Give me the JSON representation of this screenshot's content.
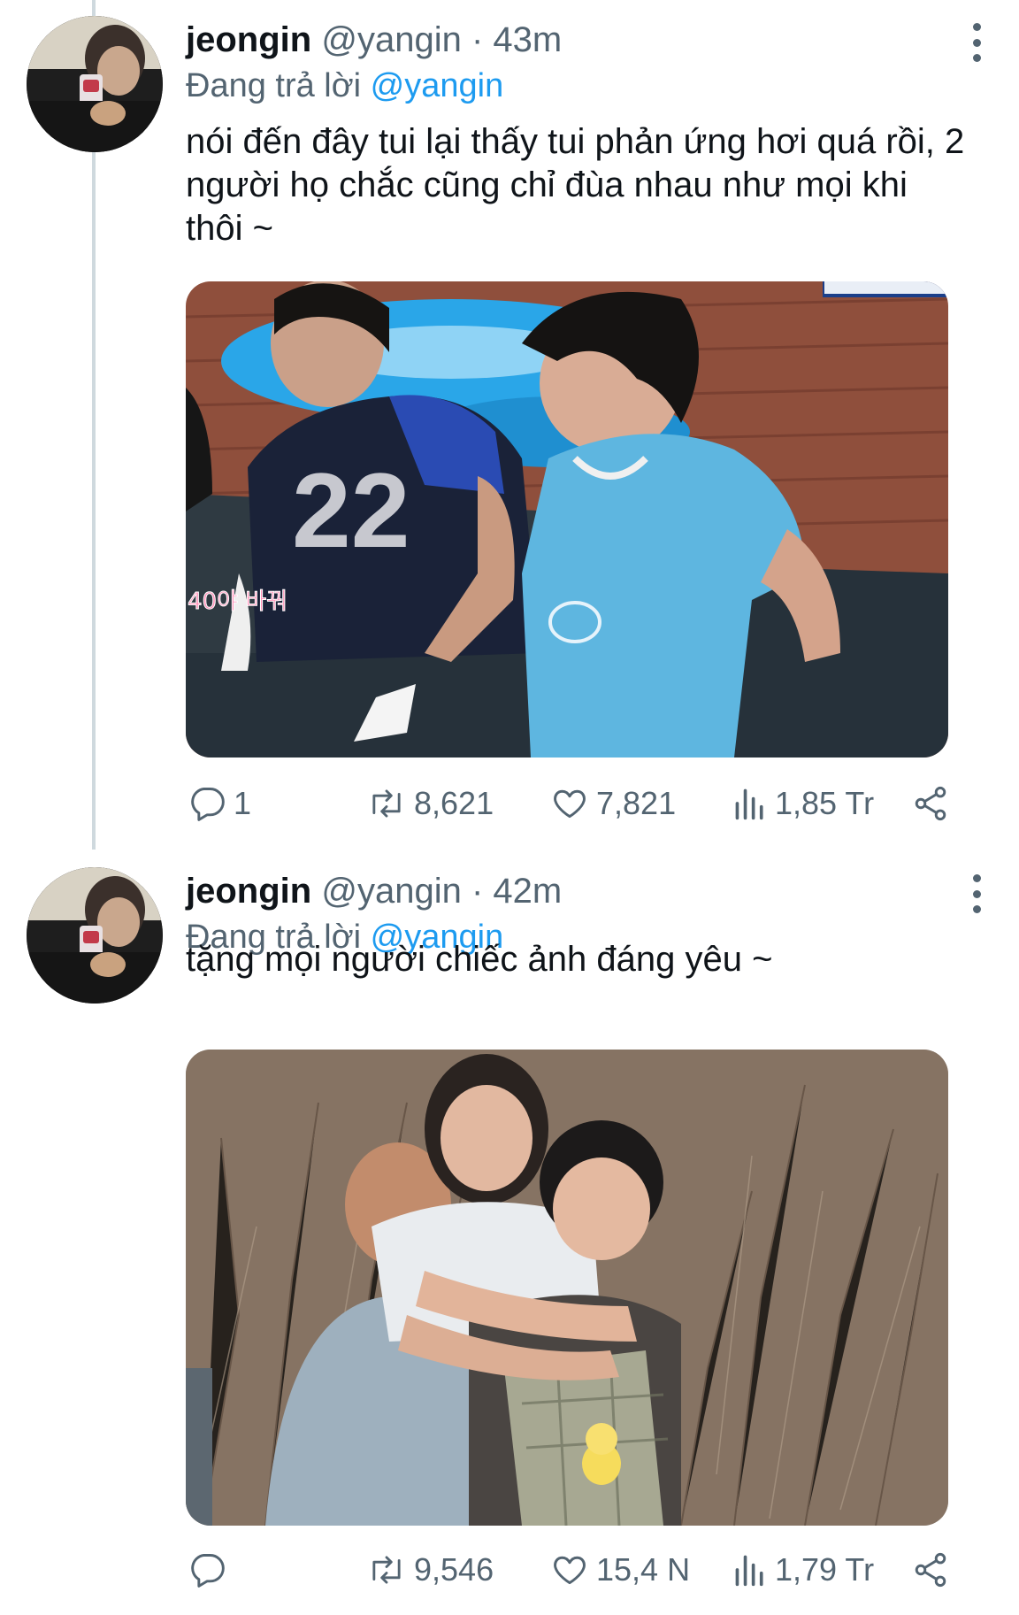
{
  "tweets": [
    {
      "display_name": "jeongin",
      "handle": "@yangin",
      "time": "43m",
      "reply_prefix": "Đang trả lời",
      "reply_mention": "@yangin",
      "text": "nói đến đây tui lại thấy tui phản ứng hơi quá rồi, 2 người họ chắc cũng chỉ đùa nhau như mọi khi thôi ~",
      "media_caption": "40야 바꿔",
      "replies": "1",
      "retweets": "8,621",
      "likes": "7,821",
      "views": "1,85 Tr"
    },
    {
      "display_name": "jeongin",
      "handle": "@yangin",
      "time": "42m",
      "reply_prefix": "Đang trả lời",
      "reply_mention": "@yangin",
      "text": "tặng mọi người chiếc ảnh đáng yêu ~",
      "replies": "",
      "retweets": "9,546",
      "likes": "15,4 N",
      "views": "1,79 Tr"
    }
  ],
  "colors": {
    "link": "#1d9bf0",
    "secondary_text": "#536471",
    "thread_line": "#cfd9de"
  },
  "icons": [
    "reply-icon",
    "retweet-icon",
    "like-icon",
    "views-icon",
    "share-icon",
    "more-options-icon"
  ]
}
